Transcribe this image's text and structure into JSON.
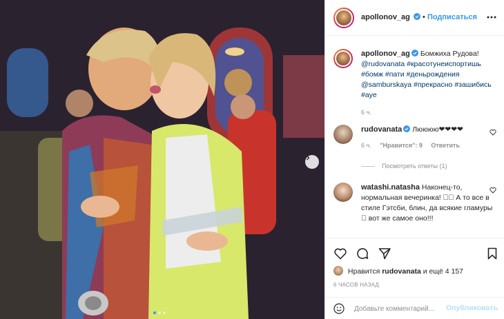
{
  "post": {
    "author": "apollonov_ag",
    "follow_label": "Подписаться",
    "caption_lines": [
      "Бомжиха Рудова!"
    ],
    "caption_tags": [
      "@rudovanata",
      "#красотунеиспортишь",
      "#бомж",
      "#пати",
      "#деньрождения",
      "@samburskaya",
      "#прекрасно",
      "#зашибись",
      "#aye"
    ],
    "caption_time": "6 ч."
  },
  "comments": [
    {
      "user": "rudovanata",
      "text": "Люююю❤❤❤❤",
      "time": "6 ч.",
      "likes": "\"Нравится\": 9",
      "reply": "Ответить",
      "view_replies": "Посмотреть ответы (1)"
    },
    {
      "user": "watashi.natasha",
      "text": "Наконец-то, нормальная вечеринка! \u0000\u0000 А то все в стиле Гэтсби, блин, да всякие гламуры \u0000 вот же самое оно!!!"
    }
  ],
  "engagement": {
    "liked_by_prefix": "Нравится",
    "liked_by_user": "rudovanata",
    "liked_by_suffix": "и ещё 4 157",
    "time_ago": "6 ЧАСОВ НАЗАД"
  },
  "composer": {
    "placeholder": "Добавьте комментарий...",
    "post_label": "Опубликовать"
  },
  "carousel": {
    "slides": 3,
    "active": 1
  },
  "colors": {
    "accent": "#3897f0",
    "link": "#00376b",
    "muted": "#8e8e8e",
    "border": "#efefef"
  },
  "icons": [
    "heart-icon",
    "comment-icon",
    "share-icon",
    "bookmark-icon",
    "emoji-icon",
    "more-icon",
    "verified-icon",
    "chevron-right-icon"
  ]
}
